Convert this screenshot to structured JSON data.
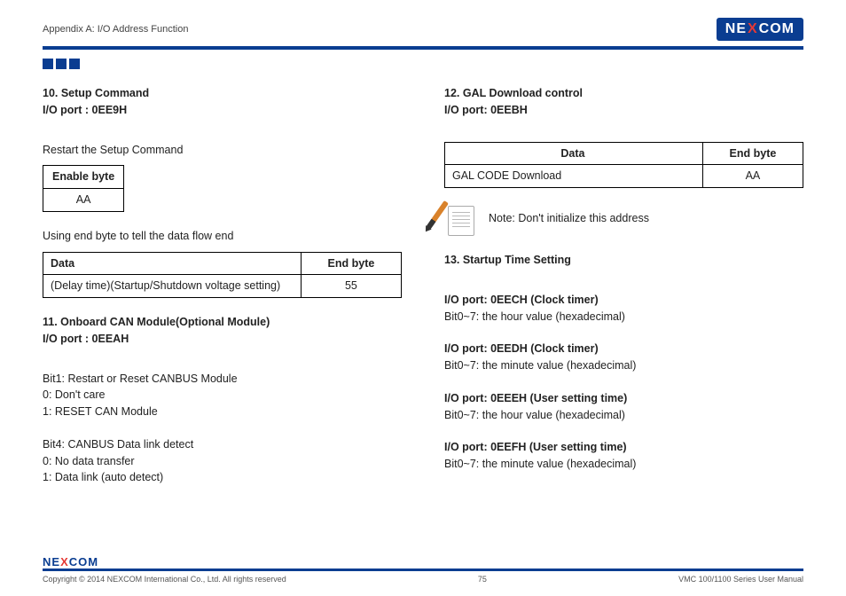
{
  "header": {
    "breadcrumb": "Appendix A: I/O Address Function",
    "logo_left": "NE",
    "logo_x": "X",
    "logo_right": "COM"
  },
  "left": {
    "sec10_title": "10. Setup Command",
    "sec10_port": "I/O port : 0EE9H",
    "restart_line": "Restart the Setup Command",
    "tbl_enable_hdr": "Enable byte",
    "tbl_enable_val": "AA",
    "endbyte_intro": "Using end byte to tell the data flow end",
    "tbl_data_hdr": "Data",
    "tbl_end_hdr": "End byte",
    "tbl_data_val": "(Delay time)(Startup/Shutdown voltage setting)",
    "tbl_end_val": "55",
    "sec11_title": "11. Onboard CAN Module(Optional Module)",
    "sec11_port": "I/O port : 0EEAH",
    "bit1_line": "Bit1: Restart or Reset CANBUS Module",
    "bit1_0": "0: Don't care",
    "bit1_1": "1: RESET CAN Module",
    "bit4_line": "Bit4: CANBUS Data link detect",
    "bit4_0": "0: No data transfer",
    "bit4_1": "1: Data link (auto detect)"
  },
  "right": {
    "sec12_title": "12. GAL Download control",
    "sec12_port": "I/O port: 0EEBH",
    "tbl_data_hdr": "Data",
    "tbl_end_hdr": "End byte",
    "tbl_data_val": "GAL CODE Download",
    "tbl_end_val": "AA",
    "note_text": "Note: Don't initialize this address",
    "sec13_title": "13. Startup Time Setting",
    "p1_hdr": "I/O port: 0EECH (Clock timer)",
    "p1_body": "Bit0~7: the hour value (hexadecimal)",
    "p2_hdr": "I/O port: 0EEDH (Clock timer)",
    "p2_body": "Bit0~7: the minute value (hexadecimal)",
    "p3_hdr": "I/O port: 0EEEH (User setting time)",
    "p3_body": "Bit0~7: the hour value (hexadecimal)",
    "p4_hdr": "I/O port: 0EEFH (User setting time)",
    "p4_body": "Bit0~7: the minute value (hexadecimal)"
  },
  "footer": {
    "copyright": "Copyright © 2014 NEXCOM International Co., Ltd. All rights reserved",
    "page": "75",
    "manual": "VMC 100/1100 Series User Manual"
  }
}
